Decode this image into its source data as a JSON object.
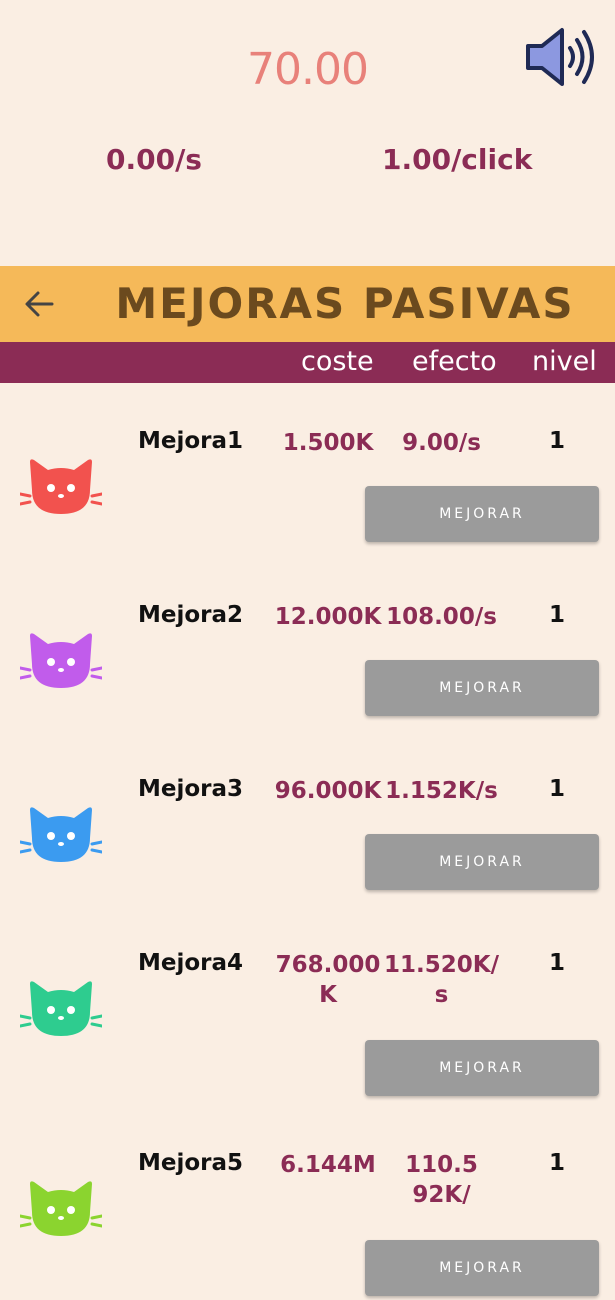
{
  "header": {
    "score": "70.00",
    "per_second": "0.00/s",
    "per_click": "1.00/click",
    "sound_icon": "speaker-volume-icon"
  },
  "title_bar": {
    "back_icon": "arrow-left-icon",
    "title": "MEJORAS PASIVAS"
  },
  "columns": {
    "cost": "coste",
    "effect": "efecto",
    "level": "nivel"
  },
  "colors": {
    "background": "#FAEEE3",
    "title_bar": "#F5B959",
    "column_bar": "#8B2C55",
    "button": "#9B9B9B",
    "score": "#E8817A"
  },
  "upgrades": [
    {
      "name": "Mejora1",
      "cost": "1.500K",
      "effect": "9.00/s",
      "level": "1",
      "button": "MEJORAR",
      "cat_color": "#F2524E",
      "icon": "cat-icon"
    },
    {
      "name": "Mejora2",
      "cost": "12.000K",
      "effect": "108.00/s",
      "level": "1",
      "button": "MEJORAR",
      "cat_color": "#C15CEB",
      "icon": "cat-icon"
    },
    {
      "name": "Mejora3",
      "cost": "96.000K",
      "effect": "1.152K/s",
      "level": "1",
      "button": "MEJORAR",
      "cat_color": "#3B9BF0",
      "icon": "cat-icon"
    },
    {
      "name": "Mejora4",
      "cost": "768.000\nK",
      "effect": "11.520K/\ns",
      "level": "1",
      "button": "MEJORAR",
      "cat_color": "#2ECC8F",
      "icon": "cat-icon"
    },
    {
      "name": "Mejora5",
      "cost": "6.144M",
      "effect": "110.5\n92K/",
      "level": "1",
      "button": "MEJORAR",
      "cat_color": "#8BD42F",
      "icon": "cat-icon"
    }
  ]
}
